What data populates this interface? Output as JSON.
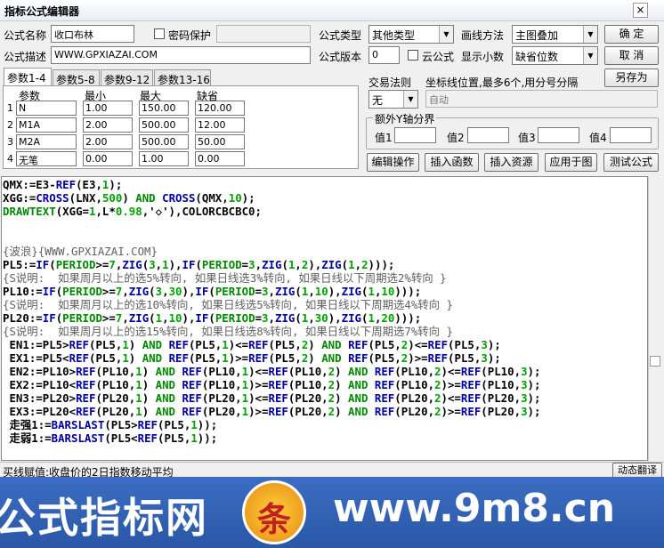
{
  "window": {
    "title": "指标公式编辑器",
    "close_glyph": "×"
  },
  "header": {
    "name_label": "公式名称",
    "name_value": "收口布林",
    "password_label": "密码保护",
    "desc_label": "公式描述",
    "desc_value": "WWW.GPXIAZAI.COM",
    "type_label": "公式类型",
    "type_value": "其他类型",
    "draw_label": "画线方法",
    "draw_value": "主图叠加",
    "version_label": "公式版本",
    "version_value": "0",
    "cloud_label": "云公式",
    "decimals_label": "显示小数",
    "decimals_value": "缺省位数"
  },
  "buttons": {
    "ok": "确  定",
    "cancel": "取  消",
    "save_as": "另存为",
    "edit_ops": "编辑操作",
    "insert_func": "插入函数",
    "insert_res": "插入资源",
    "apply_chart": "应用于图",
    "test": "测试公式",
    "translate": "动态翻译"
  },
  "tabs": [
    "参数1-4",
    "参数5-8",
    "参数9-12",
    "参数13-16"
  ],
  "params": {
    "headers": [
      "参数",
      "最小",
      "最大",
      "缺省"
    ],
    "rows": [
      {
        "idx": "1",
        "name": "N",
        "min": "1.00",
        "max": "150.00",
        "def": "120.00"
      },
      {
        "idx": "2",
        "name": "M1A",
        "min": "2.00",
        "max": "500.00",
        "def": "12.00"
      },
      {
        "idx": "3",
        "name": "M2A",
        "min": "2.00",
        "max": "500.00",
        "def": "50.00"
      },
      {
        "idx": "4",
        "name": "无笔",
        "min": "0.00",
        "max": "1.00",
        "def": "0.00"
      }
    ]
  },
  "trade": {
    "label": "交易法则",
    "value": "无",
    "coord_label": "坐标线位置,最多6个,用分号分隔",
    "coord_value": "自动"
  },
  "yaxis": {
    "label": "额外Y轴分界",
    "v1": "值1",
    "v2": "值2",
    "v3": "值3",
    "v4": "值4"
  },
  "status_text": "买线赋值:收盘价的2日指数移动平均",
  "banner": {
    "left_text": "公式指标网",
    "right_text": "www.9m8.cn",
    "logo_char": "条",
    "logo_sub": "www.9m8.cn"
  }
}
